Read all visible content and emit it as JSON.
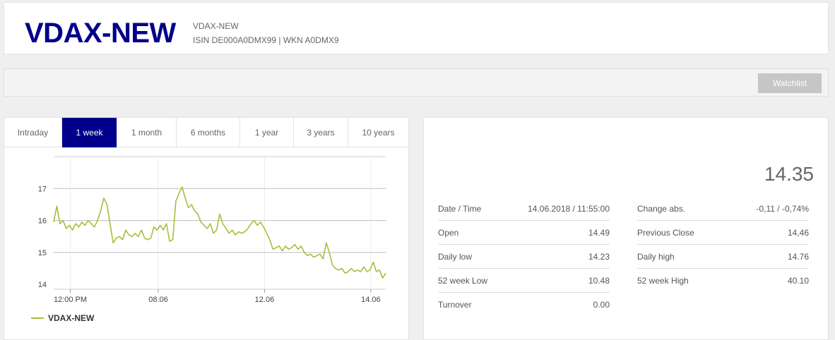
{
  "header": {
    "title": "VDAX-NEW",
    "subname": "VDAX-NEW",
    "isin_line": "ISIN DE000A0DMX99 | WKN A0DMX9"
  },
  "toolbar": {
    "watchlist_label": "Watchlist"
  },
  "tabs": [
    {
      "label": "Intraday",
      "active": false
    },
    {
      "label": "1 week",
      "active": true
    },
    {
      "label": "1 month",
      "active": false
    },
    {
      "label": "6 months",
      "active": false
    },
    {
      "label": "1 year",
      "active": false
    },
    {
      "label": "3 years",
      "active": false
    },
    {
      "label": "10 years",
      "active": false
    }
  ],
  "chart_data": {
    "type": "line",
    "y_ticks": [
      14,
      15,
      16,
      17
    ],
    "ylim": [
      13.85,
      18
    ],
    "x_tick_labels": [
      "12:00 PM",
      "08.06",
      "12.06",
      "14.06"
    ],
    "x_tick_positions": [
      0.05,
      0.315,
      0.635,
      0.955
    ],
    "grid": true,
    "legend_position": "bottom-left",
    "series": [
      {
        "name": "VDAX-NEW",
        "color": "#a9be3a",
        "values": [
          15.95,
          16.45,
          15.9,
          16.0,
          15.75,
          15.85,
          15.7,
          15.9,
          15.8,
          15.95,
          15.85,
          16.0,
          15.9,
          15.8,
          16.0,
          16.3,
          16.7,
          16.5,
          15.9,
          15.3,
          15.45,
          15.5,
          15.4,
          15.7,
          15.55,
          15.5,
          15.6,
          15.5,
          15.7,
          15.45,
          15.4,
          15.45,
          15.8,
          15.7,
          15.85,
          15.7,
          15.9,
          15.35,
          15.4,
          16.6,
          16.85,
          17.05,
          16.7,
          16.4,
          16.5,
          16.3,
          16.2,
          15.95,
          15.85,
          15.75,
          15.9,
          15.6,
          15.7,
          16.2,
          15.9,
          15.75,
          15.6,
          15.7,
          15.55,
          15.65,
          15.6,
          15.65,
          15.75,
          15.9,
          16.0,
          15.85,
          15.95,
          15.8,
          15.6,
          15.4,
          15.1,
          15.15,
          15.2,
          15.05,
          15.2,
          15.1,
          15.15,
          15.25,
          15.1,
          15.2,
          15.0,
          14.9,
          14.95,
          14.85,
          14.9,
          14.95,
          14.8,
          15.3,
          15.0,
          14.6,
          14.5,
          14.45,
          14.5,
          14.35,
          14.4,
          14.5,
          14.4,
          14.45,
          14.4,
          14.55,
          14.4,
          14.45,
          14.7,
          14.4,
          14.45,
          14.2,
          14.35
        ]
      }
    ]
  },
  "last_price": "14.35",
  "quote_left": [
    {
      "label": "Date / Time",
      "value": "14.06.2018 / 11:55:00"
    },
    {
      "label": "Open",
      "value": "14.49"
    },
    {
      "label": "Daily low",
      "value": "14.23"
    },
    {
      "label": "52 week Low",
      "value": "10.48"
    },
    {
      "label": "Turnover",
      "value": "0.00"
    }
  ],
  "quote_right": [
    {
      "label": "Change abs.",
      "value": "-0,11 / -0,74%"
    },
    {
      "label": "Previous Close",
      "value": "14,46"
    },
    {
      "label": "Daily high",
      "value": "14.76"
    },
    {
      "label": "52 week High",
      "value": "40.10"
    }
  ]
}
